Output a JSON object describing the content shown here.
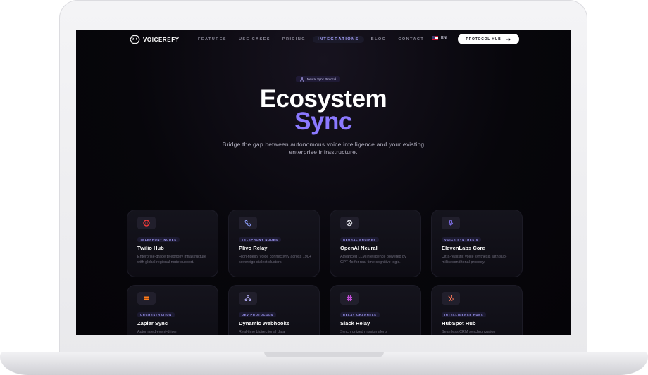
{
  "nav": {
    "brand": "VOICEREFY",
    "links": [
      "FEATURES",
      "USE CASES",
      "PRICING",
      "INTEGRATIONS",
      "BLOG",
      "CONTACT"
    ],
    "active_link": "INTEGRATIONS",
    "language": "EN",
    "cta": "PROTOCOL HUB"
  },
  "hero": {
    "badge": "Neural Sync Protocol",
    "title_line1": "Ecosystem",
    "title_line2": "Sync",
    "subtitle": "Bridge the gap between autonomous voice intelligence and your existing enterprise infrastructure."
  },
  "cards": [
    {
      "tag": "TELEPHONY NODES",
      "title": "Twilio Hub",
      "desc": "Enterprise-grade telephony infrastructure with global regional node support.",
      "icon": "twilio-icon",
      "icon_color": "#ff3b3b"
    },
    {
      "tag": "TELEPHONY NODES",
      "title": "Plivo Relay",
      "desc": "High-fidelity voice connectivity across 190+ sovereign dialect clusters.",
      "icon": "phone-icon",
      "icon_color": "#8fa0ff"
    },
    {
      "tag": "NEURAL ENGINES",
      "title": "OpenAI Neural",
      "desc": "Advanced LLM intelligence powered by GPT-4o for real-time cognitive logic.",
      "icon": "openai-icon",
      "icon_color": "#e6e6ee"
    },
    {
      "tag": "VOICE SYNTHESIS",
      "title": "ElevenLabs Core",
      "desc": "Ultra-realistic voice synthesis with sub-millisecond tonal prosody.",
      "icon": "microphone-icon",
      "icon_color": "#8b79ff"
    },
    {
      "tag": "ORCHESTRATION",
      "title": "Zapier Sync",
      "desc": "Automated event-driven",
      "icon": "zapier-icon",
      "icon_color": "#ff7a1a"
    },
    {
      "tag": "DEV PROTOCOLS",
      "title": "Dynamic Webhooks",
      "desc": "Real-time bidirectional data",
      "icon": "webhook-icon",
      "icon_color": "#b9b3ff"
    },
    {
      "tag": "RELAY CHANNELS",
      "title": "Slack Relay",
      "desc": "Synchronized mission alerts",
      "icon": "slack-icon",
      "icon_color": "#c04cd6"
    },
    {
      "tag": "INTELLIGENCE HUBS",
      "title": "HubSpot Hub",
      "desc": "Seamless CRM synchronization",
      "icon": "hubspot-icon",
      "icon_color": "#ff7a59"
    }
  ]
}
